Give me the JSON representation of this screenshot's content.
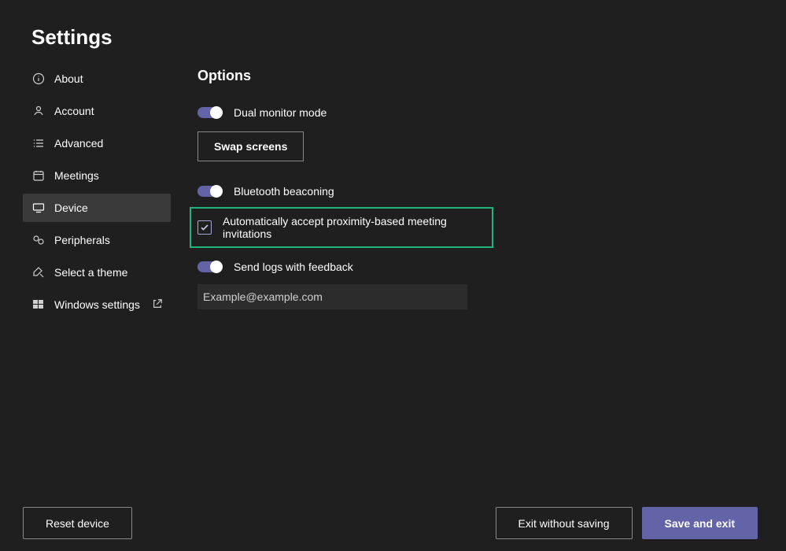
{
  "page_title": "Settings",
  "sidebar": {
    "items": [
      {
        "label": "About"
      },
      {
        "label": "Account"
      },
      {
        "label": "Advanced"
      },
      {
        "label": "Meetings"
      },
      {
        "label": "Device"
      },
      {
        "label": "Peripherals"
      },
      {
        "label": "Select a theme"
      },
      {
        "label": "Windows settings"
      }
    ],
    "selected_index": 4
  },
  "options": {
    "title": "Options",
    "dual_monitor_label": "Dual monitor mode",
    "swap_button_label": "Swap screens",
    "bluetooth_label": "Bluetooth beaconing",
    "auto_accept_label": "Automatically accept proximity-based meeting invitations",
    "send_logs_label": "Send logs with feedback",
    "email_value": "Example@example.com",
    "dual_monitor_on": true,
    "bluetooth_on": true,
    "auto_accept_checked": true,
    "send_logs_on": true
  },
  "footer": {
    "reset_label": "Reset device",
    "exit_label": "Exit without saving",
    "save_label": "Save and exit"
  },
  "colors": {
    "accent": "#6264a7",
    "highlight_border": "#1fb47b",
    "bg": "#201f1f",
    "sidebar_selected": "#3b3a3a"
  }
}
